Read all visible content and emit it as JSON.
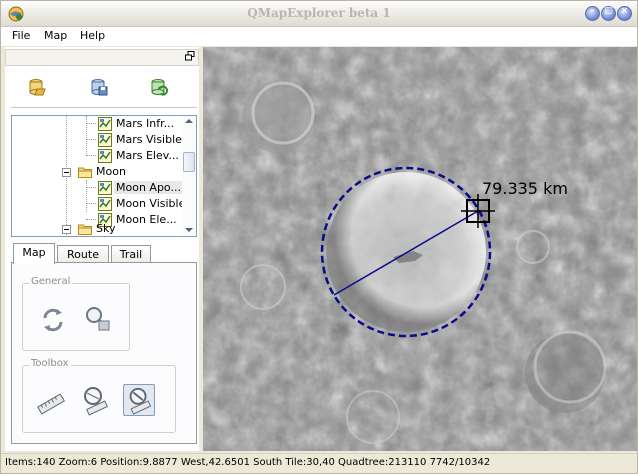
{
  "window": {
    "title": "QMapExplorer beta 1",
    "buttons": {
      "minimize": "–",
      "maximize": "□",
      "close": "×"
    }
  },
  "menu": {
    "items": [
      "File",
      "Map",
      "Help"
    ]
  },
  "dock": {
    "toolbar": [
      {
        "icon": "open-cache-icon"
      },
      {
        "icon": "save-disk-icon"
      },
      {
        "icon": "refresh-layers-icon"
      }
    ]
  },
  "tree": {
    "rows": [
      {
        "label": "Mars Infr...",
        "icon": "map-layer-icon",
        "level": 2
      },
      {
        "label": "Mars Visible",
        "icon": "map-layer-icon",
        "level": 2
      },
      {
        "label": "Mars Elev...",
        "icon": "map-layer-icon",
        "level": 2
      },
      {
        "label": "Moon",
        "icon": "folder-icon",
        "level": 1
      },
      {
        "label": "Moon Apo...",
        "icon": "map-layer-icon",
        "level": 2,
        "selected": true
      },
      {
        "label": "Moon Visible",
        "icon": "map-layer-icon",
        "level": 2
      },
      {
        "label": "Moon Ele...",
        "icon": "map-layer-icon",
        "level": 2
      },
      {
        "label": "Sky",
        "icon": "folder-icon",
        "level": 1
      }
    ]
  },
  "tabs": {
    "items": [
      "Map",
      "Route",
      "Trail"
    ],
    "active": 0
  },
  "groups": {
    "general": "General",
    "toolbox": "Toolbox"
  },
  "map": {
    "measurement": "79.335 km",
    "circle_color": "#0a0a8c"
  },
  "status": {
    "text": "Items:140  Zoom:6  Position:9.8877 West,42.6501 South  Tile:30,40  Quadtree:213110  7742/10342"
  }
}
